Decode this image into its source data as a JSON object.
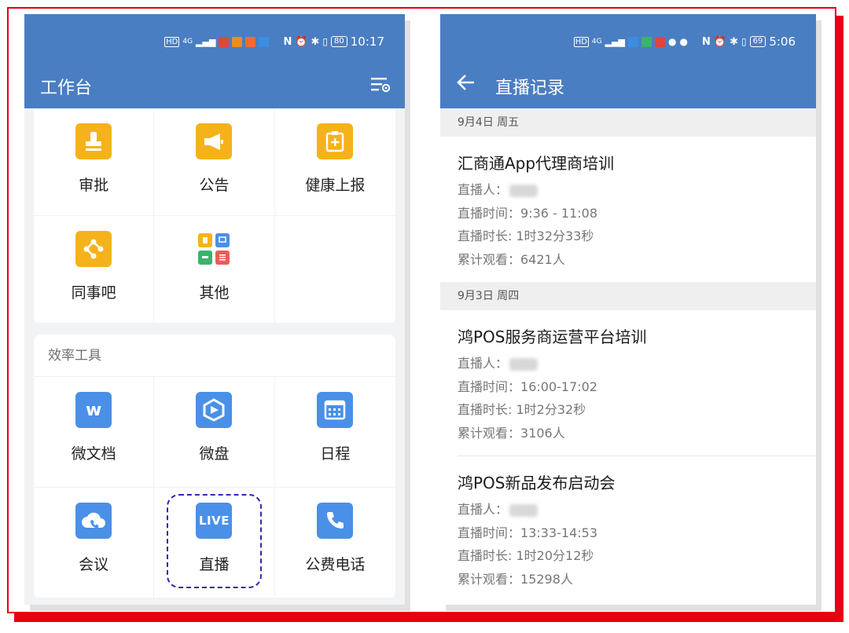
{
  "left": {
    "status": {
      "time": "10:17",
      "battery": "80",
      "network": "4G",
      "hd": "HD"
    },
    "title": "工作台",
    "apps": [
      {
        "label": "审批",
        "icon": "stamp-icon",
        "color": "#f5b21a"
      },
      {
        "label": "公告",
        "icon": "megaphone-icon",
        "color": "#f5b21a"
      },
      {
        "label": "健康上报",
        "icon": "clipboard-plus-icon",
        "color": "#f5b21a"
      },
      {
        "label": "同事吧",
        "icon": "network-nodes-icon",
        "color": "#f5b21a"
      },
      {
        "label": "其他",
        "icon": "app-grid-icon",
        "color": "#ffffff"
      }
    ],
    "tools_section": "效率工具",
    "tools": [
      {
        "label": "微文档",
        "icon": "document-w-icon",
        "color": "#4a90e8"
      },
      {
        "label": "微盘",
        "icon": "cloud-drive-icon",
        "color": "#4a90e8"
      },
      {
        "label": "日程",
        "icon": "calendar-icon",
        "color": "#4a90e8"
      },
      {
        "label": "会议",
        "icon": "cloud-phone-icon",
        "color": "#4a90e8"
      },
      {
        "label": "直播",
        "icon": "live-icon",
        "color": "#4a90e8",
        "badge": "LIVE"
      },
      {
        "label": "公费电话",
        "icon": "phone-icon",
        "color": "#4a90e8"
      }
    ]
  },
  "right": {
    "status": {
      "time": "5:06",
      "battery": "69",
      "network": "4G",
      "hd": "HD"
    },
    "title": "直播记录",
    "groups": [
      {
        "date": "9月4日 周五",
        "records": [
          {
            "title": "汇商通App代理商培训",
            "host_label": "直播人：",
            "time_label": "直播时间：",
            "time": "9:36 - 11:08",
            "duration_label": "直播时长: ",
            "duration": "1时32分33秒",
            "views_label": "累计观看：",
            "views": "6421人"
          }
        ]
      },
      {
        "date": "9月3日 周四",
        "records": [
          {
            "title": "鸿POS服务商运营平台培训",
            "host_label": "直播人：",
            "time_label": "直播时间：",
            "time": "16:00-17:02",
            "duration_label": "直播时长: ",
            "duration": "1时2分32秒",
            "views_label": "累计观看：",
            "views": "3106人"
          },
          {
            "title": "鸿POS新品发布启动会",
            "host_label": "直播人：",
            "time_label": "直播时间：",
            "time": "13:33-14:53",
            "duration_label": "直播时长: ",
            "duration": "1时20分12秒",
            "views_label": "累计观看：",
            "views": "15298人"
          }
        ]
      }
    ]
  },
  "colors": {
    "appbar": "#4a7ec2",
    "frame": "#e60012",
    "highlight": "#2b2bb0"
  }
}
